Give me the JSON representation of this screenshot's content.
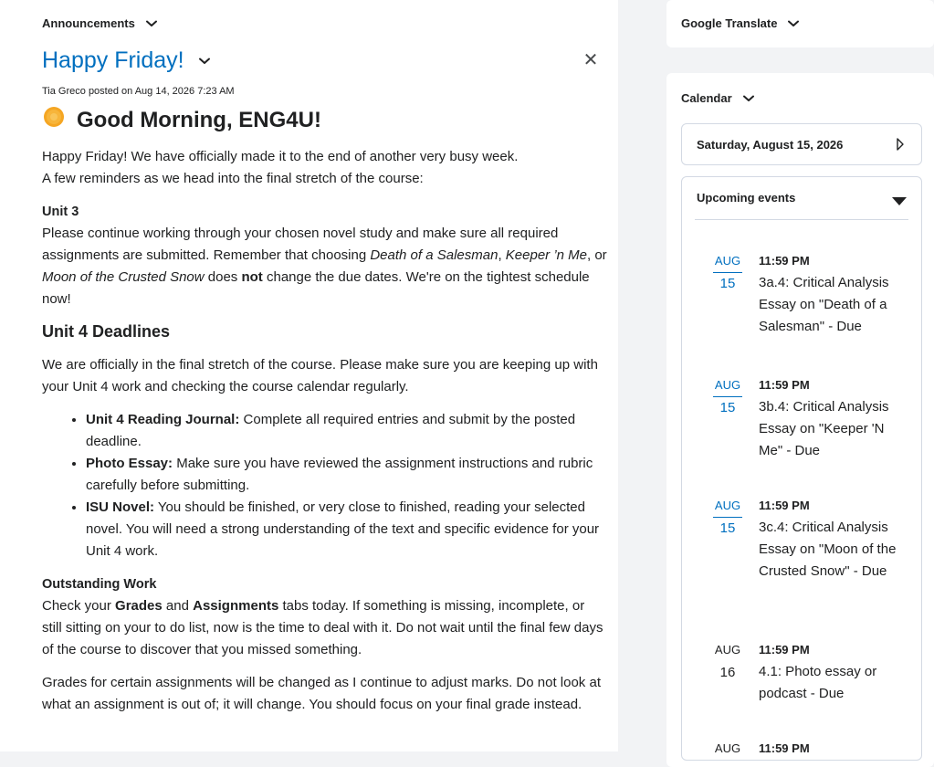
{
  "announcements": {
    "widget_title": "Announcements",
    "title": "Happy Friday!",
    "byline": "Tia Greco posted on Aug 14, 2026 7:23 AM",
    "greeting": "Good Morning, ENG4U!",
    "intro_line1": "Happy Friday! We have officially made it to the end of another very busy week.",
    "intro_line2": "A few reminders as we head into the final stretch of the course:",
    "unit3_heading": "Unit 3",
    "unit3_p_a": "Please continue working through your chosen novel study and make sure all required assignments are submitted. Remember that choosing ",
    "unit3_em1": "Death of a Salesman",
    "unit3_sep1": ", ",
    "unit3_em2": "Keeper ’n Me",
    "unit3_sep2": ", or ",
    "unit3_em3": "Moon of the Crusted Snow",
    "unit3_p_b": " does ",
    "unit3_strong": "not",
    "unit3_p_c": " change the due dates. We're on the tightest schedule now!",
    "unit4_heading": "Unit 4 Deadlines",
    "unit4_intro": "We are officially in the final stretch of the course. Please make sure you are keeping up with your Unit 4 work and checking the course calendar regularly.",
    "bullets": [
      {
        "label": "Unit 4 Reading Journal:",
        "text": " Complete all required entries and submit by the posted deadline."
      },
      {
        "label": "Photo Essay:",
        "text": " Make sure you have reviewed the assignment instructions and rubric carefully before submitting."
      },
      {
        "label": "ISU Novel:",
        "text": " You should be finished, or very close to finished, reading your selected novel. You will need a strong understanding of the text and specific evidence for your Unit 4 work."
      }
    ],
    "outstanding_heading": "Outstanding Work",
    "outstanding_a": "Check your ",
    "outstanding_grades": "Grades",
    "outstanding_and": " and ",
    "outstanding_assignments": "Assignments",
    "outstanding_b": " tabs today. If something is missing, incomplete, or still sitting on your to do list, now is the time to deal with it. Do not wait until the final few days of the course to discover that you missed something.",
    "grades_note": "Grades for certain assignments will be changed as I continue to adjust marks. Do not look at what an assignment is out of; it will change. You should focus on your final grade instead."
  },
  "google_translate": {
    "widget_title": "Google Translate"
  },
  "calendar": {
    "widget_title": "Calendar",
    "selected_date": "Saturday, August 15, 2026",
    "upcoming_label": "Upcoming events",
    "events": [
      {
        "month": "AUG",
        "day": "15",
        "time": "11:59 PM",
        "title": "3a.4: Critical Analysis Essay on \"Death of a Salesman\" - Due"
      },
      {
        "month": "AUG",
        "day": "15",
        "time": "11:59 PM",
        "title": "3b.4: Critical Analysis Essay on \"Keeper 'N Me\" - Due"
      },
      {
        "month": "AUG",
        "day": "15",
        "time": "11:59 PM",
        "title": "3c.4: Critical Analysis Essay on \"Moon of the Crusted Snow\" - Due"
      },
      {
        "month": "AUG",
        "day": "16",
        "time": "11:59 PM",
        "title": "4.1: Photo essay or podcast - Due"
      },
      {
        "month": "AUG",
        "day": "",
        "time": "11:59 PM",
        "title": ""
      }
    ]
  },
  "colors": {
    "link": "#006fbf",
    "text": "#202122",
    "background": "#f2f3f5",
    "card": "#ffffff",
    "border": "#d3d9e3",
    "sun_emoji": "#f5a623"
  },
  "icons": {
    "widget_chevron": "chevron-down-icon",
    "close": "close-icon",
    "next_day": "chevron-right-icon",
    "events_toggle": "caret-down-icon",
    "emoji": "sun-emoji-icon"
  }
}
